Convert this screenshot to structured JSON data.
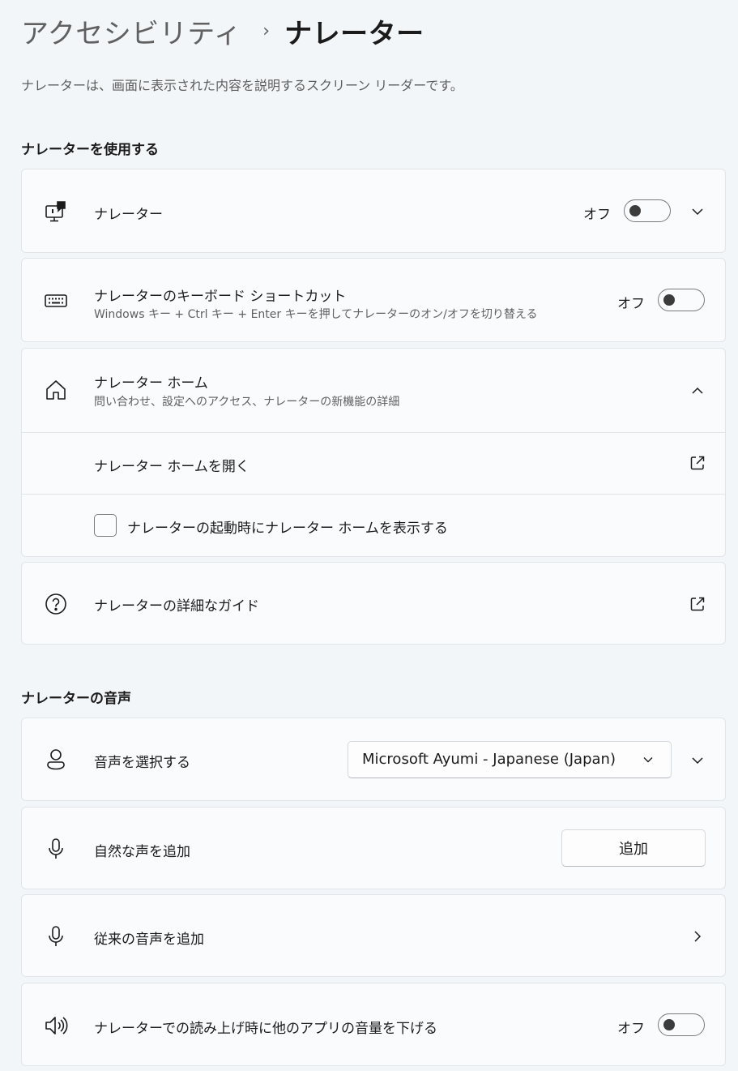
{
  "breadcrumb": {
    "parent": "アクセシビリティ",
    "separator": "›",
    "current": "ナレーター"
  },
  "description": "ナレーターは、画面に表示された内容を説明するスクリーン リーダーです。",
  "sections": {
    "use": "ナレーターを使用する",
    "voice": "ナレーターの音声"
  },
  "narrator": {
    "label": "ナレーター",
    "state": "オフ",
    "on": false
  },
  "shortcut": {
    "label": "ナレーターのキーボード ショートカット",
    "sublabel": "Windows キー + Ctrl キー + Enter キーを押してナレーターのオン/オフを切り替える",
    "state": "オフ",
    "on": false
  },
  "home": {
    "label": "ナレーター ホーム",
    "sublabel": "問い合わせ、設定へのアクセス、ナレーターの新機能の詳細",
    "open_label": "ナレーター ホームを開く",
    "checkbox_label": "ナレーターの起動時にナレーター ホームを表示する",
    "checkbox_checked": false
  },
  "guide": {
    "label": "ナレーターの詳細なガイド"
  },
  "choose_voice": {
    "label": "音声を選択する",
    "selected": "Microsoft Ayumi - Japanese (Japan)"
  },
  "natural_voice": {
    "label": "自然な声を追加",
    "button": "追加"
  },
  "legacy_voice": {
    "label": "従来の音声を追加"
  },
  "lower_volume": {
    "label": "ナレーターでの読み上げ時に他のアプリの音量を下げる",
    "state": "オフ",
    "on": false
  },
  "colors": {
    "background": "#f3f6f9",
    "card": "#f9fbfd",
    "border": "#e1e4e8",
    "toggle_knob": "#3c3c3c"
  }
}
